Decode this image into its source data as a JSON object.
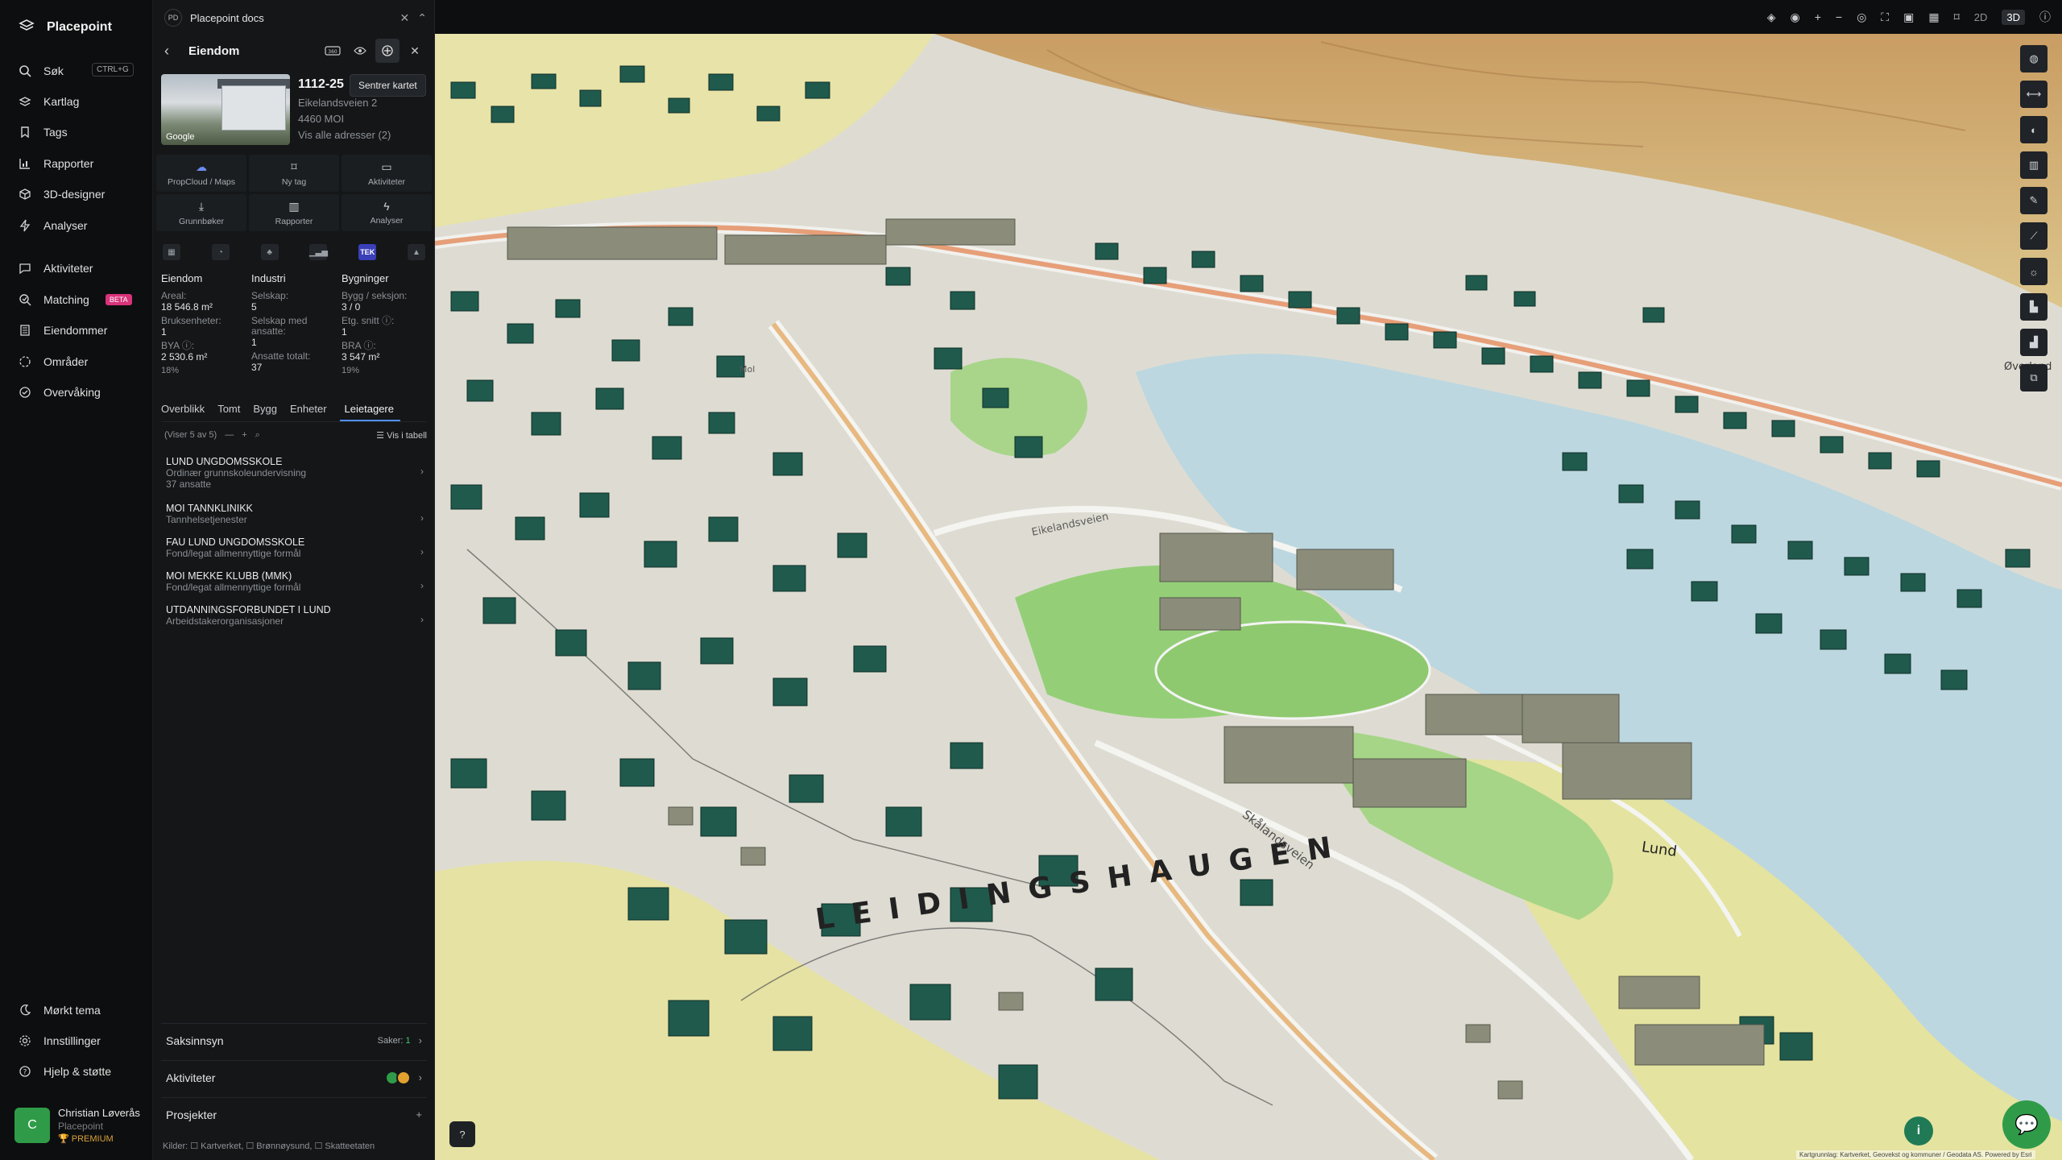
{
  "app": {
    "name": "Placepoint"
  },
  "nav": {
    "items": [
      {
        "label": "Søk",
        "icon": "search-icon",
        "shortcut": "CTRL+G"
      },
      {
        "label": "Kartlag",
        "icon": "layers-icon"
      },
      {
        "label": "Tags",
        "icon": "bookmark-icon"
      },
      {
        "label": "Rapporter",
        "icon": "chart-icon"
      },
      {
        "label": "3D-designer",
        "icon": "cube-icon"
      },
      {
        "label": "Analyser",
        "icon": "bolt-icon"
      },
      {
        "label": "Aktiviteter",
        "icon": "message-icon"
      },
      {
        "label": "Matching",
        "icon": "match-icon",
        "badge": "BETA"
      },
      {
        "label": "Eiendommer",
        "icon": "building-icon"
      },
      {
        "label": "Områder",
        "icon": "area-icon"
      },
      {
        "label": "Overvåking",
        "icon": "monitor-icon"
      }
    ],
    "bottom": [
      {
        "label": "Mørkt tema",
        "icon": "moon-icon"
      },
      {
        "label": "Innstillinger",
        "icon": "gear-icon"
      },
      {
        "label": "Hjelp & støtte",
        "icon": "help-icon"
      }
    ]
  },
  "user": {
    "initial": "C",
    "name": "Christian Løverås",
    "org": "Placepoint",
    "plan": "PREMIUM"
  },
  "docs": {
    "badge": "PD",
    "title": "Placepoint docs"
  },
  "panel": {
    "title": "Eiendom",
    "tooltip": "Sentrer kartet",
    "photo_credit": "Google",
    "property": {
      "id": "1112-25",
      "address": "Eikelandsveien 2",
      "postal": "4460 MOI",
      "all_addresses": "Vis alle adresser (2)"
    },
    "actions": [
      {
        "label": "PropCloud / Maps",
        "icon": "cloud-icon"
      },
      {
        "label": "Ny tag",
        "icon": "bookmark-icon"
      },
      {
        "label": "Aktiviteter",
        "icon": "message-icon"
      },
      {
        "label": "Grunnbøker",
        "icon": "download-icon"
      },
      {
        "label": "Rapporter",
        "icon": "chart-icon"
      },
      {
        "label": "Analyser",
        "icon": "bolt-icon"
      }
    ],
    "chip_tek": "TEK",
    "stats": {
      "eiendom": {
        "header": "Eiendom",
        "areal_k": "Areal:",
        "areal_v": "18 546.8 m²",
        "bruk_k": "Bruksenheter:",
        "bruk_v": "1",
        "bya_k": "BYA ⓘ:",
        "bya_v": "2 530.6 m²",
        "bya_p": "18%"
      },
      "industri": {
        "header": "Industri",
        "sel_k": "Selskap:",
        "sel_v": "5",
        "ans_k": "Selskap med ansatte:",
        "ans_v": "1",
        "tot_k": "Ansatte totalt:",
        "tot_v": "37"
      },
      "bygninger": {
        "header": "Bygninger",
        "bygg_k": "Bygg / seksjon:",
        "bygg_v": "3 / 0",
        "etg_k": "Etg. snitt ⓘ:",
        "etg_v": "1",
        "bra_k": "BRA ⓘ:",
        "bra_v": "3 547 m²",
        "bra_p": "19%"
      }
    },
    "tabs": [
      "Overblikk",
      "Tomt",
      "Bygg",
      "Enheter",
      "Leietagere"
    ],
    "list_info": "(Viser 5 av 5)",
    "list_table": "Vis i tabell",
    "tenants": [
      {
        "name": "LUND UNGDOMSSKOLE",
        "desc": "Ordinær grunnskoleundervisning",
        "extra": "37 ansatte"
      },
      {
        "name": "MOI TANNKLINIKK",
        "desc": "Tannhelsetjenester"
      },
      {
        "name": "FAU LUND UNGDOMSSKOLE",
        "desc": "Fond/legat allmennyttige formål"
      },
      {
        "name": "MOI MEKKE KLUBB (MMK)",
        "desc": "Fond/legat allmennyttige formål"
      },
      {
        "name": "UTDANNINGSFORBUNDET I LUND",
        "desc": "Arbeidstakerorganisasjoner"
      }
    ],
    "sections": {
      "saksinnsyn": {
        "title": "Saksinnsyn",
        "count_label": "Saker:",
        "count": "1"
      },
      "aktiviteter": {
        "title": "Aktiviteter"
      },
      "prosjekter": {
        "title": "Prosjekter"
      }
    },
    "sources": "Kilder: ☐ Kartverket, ☐ Brønnøysund, ☐ Skatteetaten"
  },
  "map": {
    "labels": {
      "area": "LEIDINGSHAUGEN",
      "lund": "Lund",
      "skaland": "Skålandsveien",
      "eikeland": "Eikelandsveien",
      "overland": "Øverland",
      "mol": "Mol"
    },
    "mode_2d": "2D",
    "mode_3d": "3D",
    "attribution": "Kartgrunnlag: Kartverket, Geovekst og kommuner / Geodata AS. Powered by Esri"
  },
  "colors": {
    "accent": "#2f9b48",
    "beta": "#d9337a",
    "building": "#1f5a4d"
  }
}
